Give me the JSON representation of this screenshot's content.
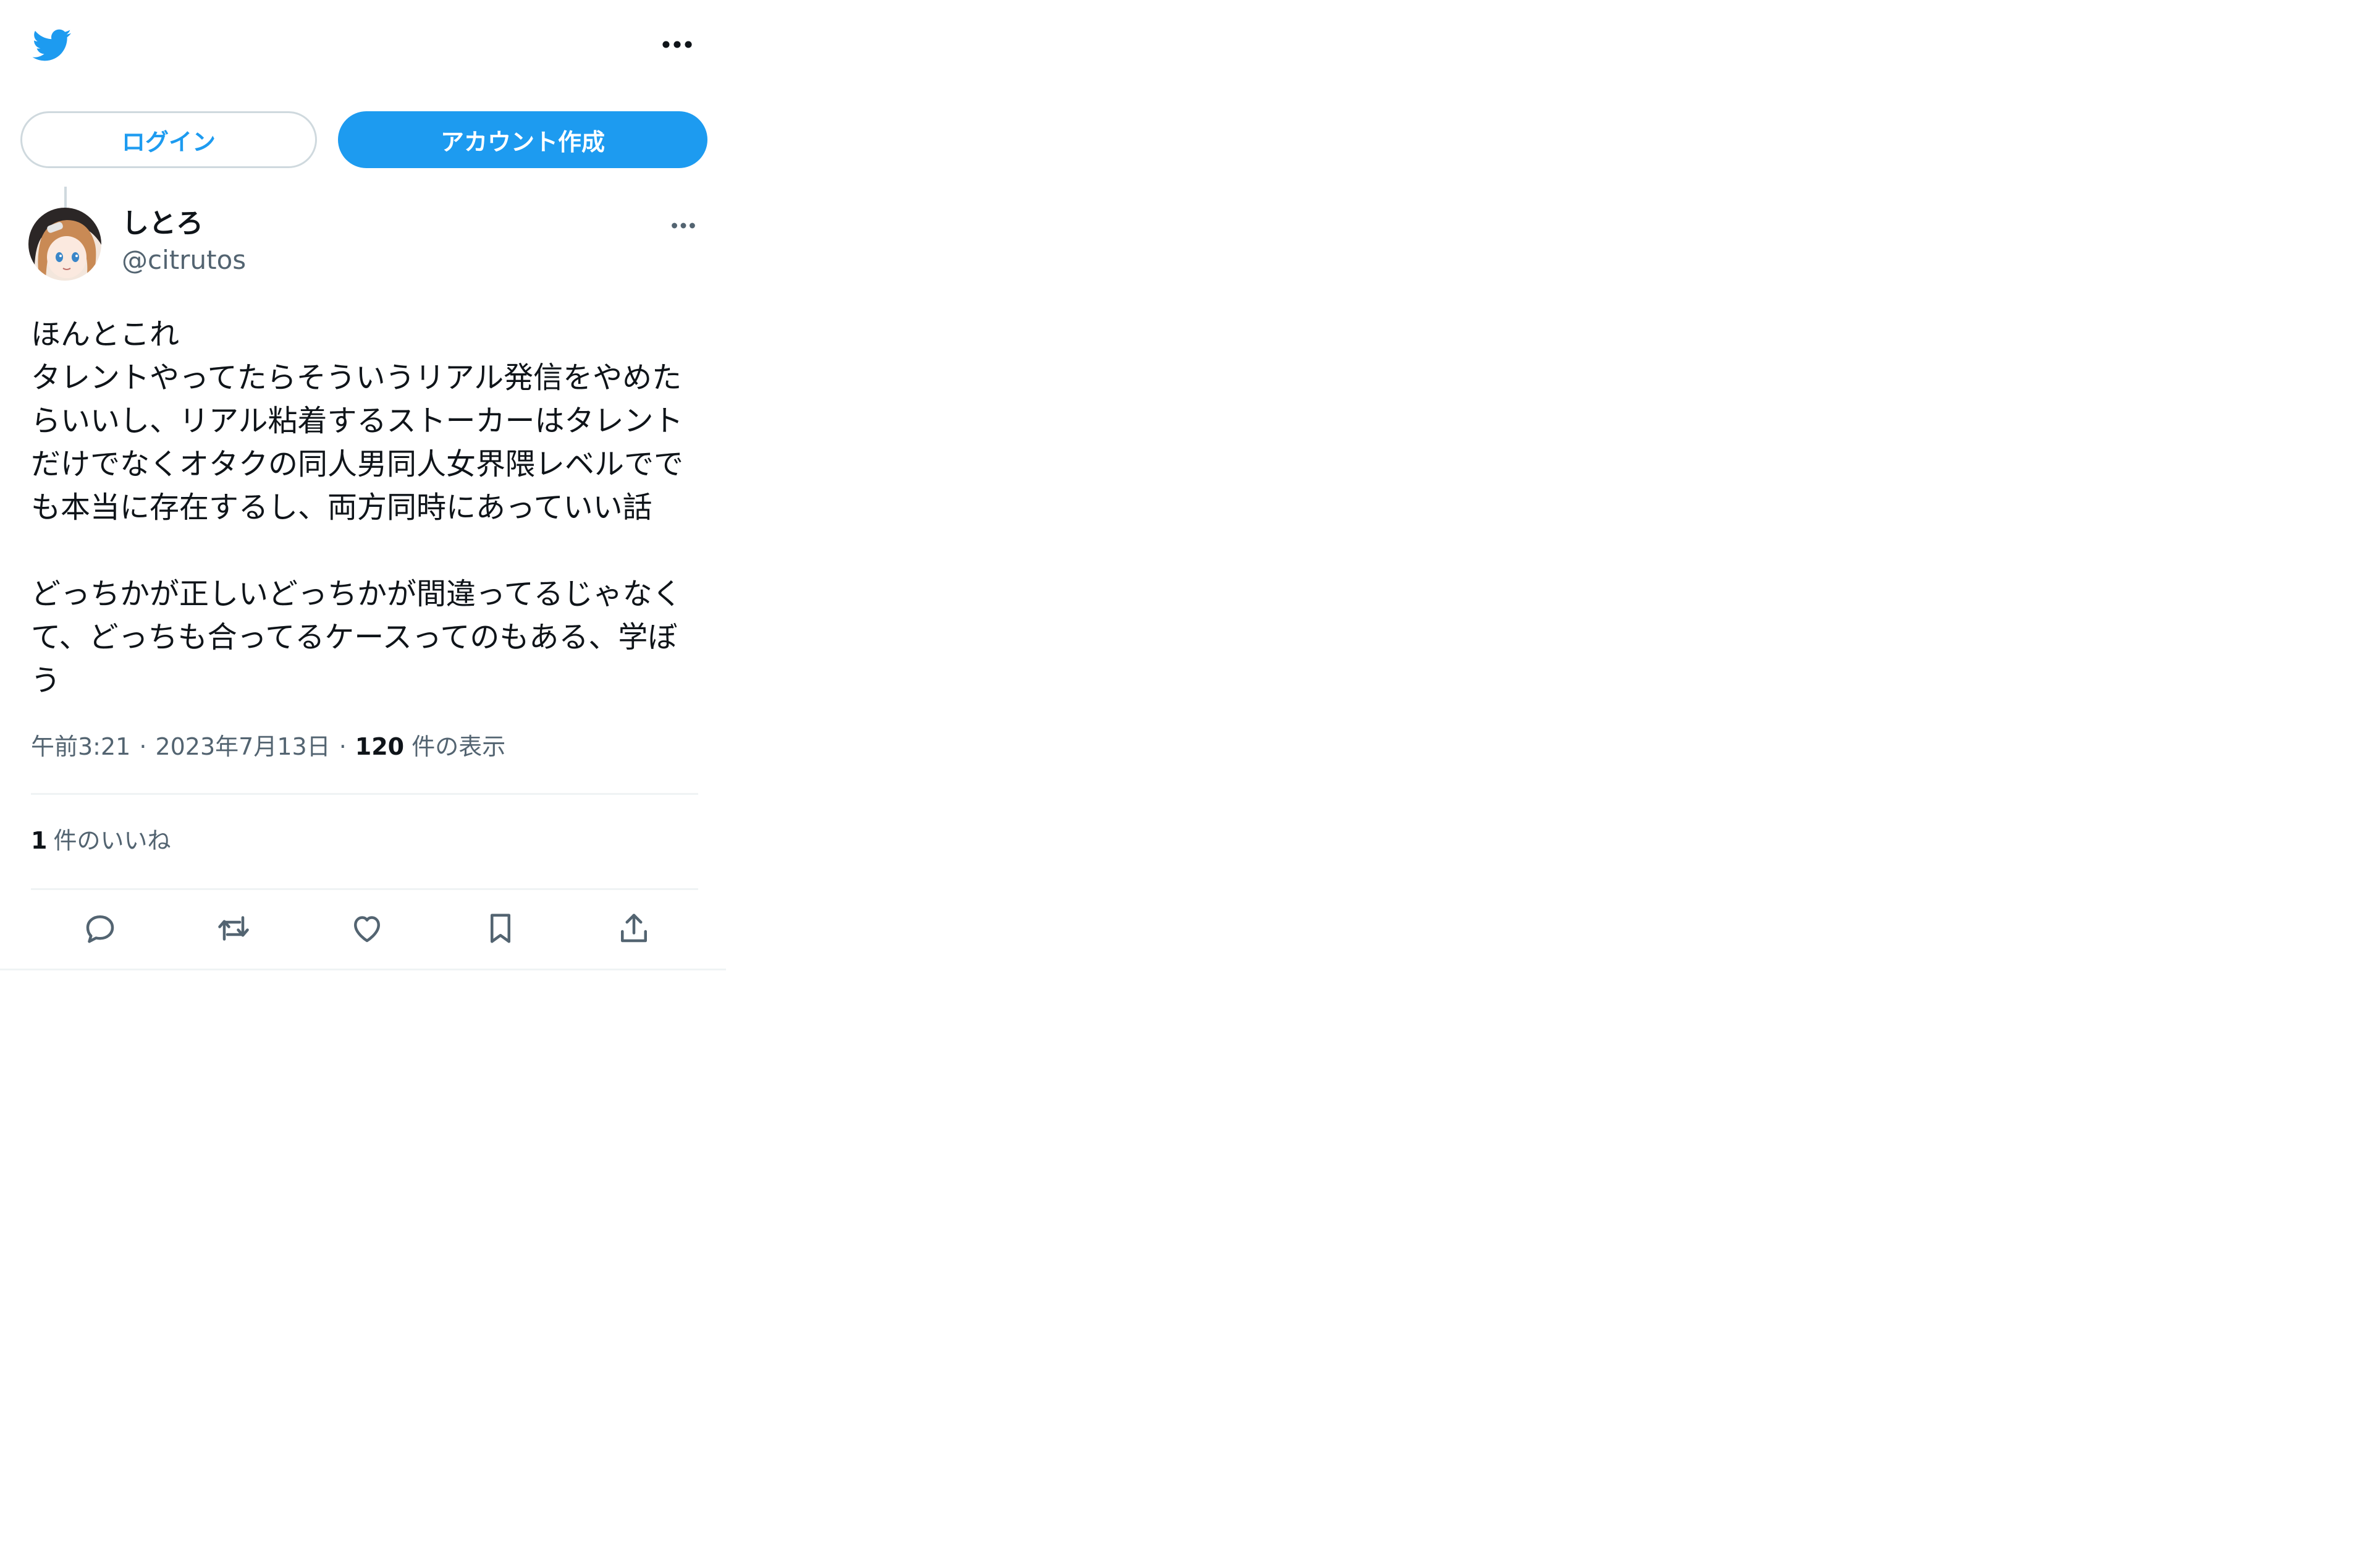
{
  "header": {
    "logo_icon": "twitter-bird-icon",
    "more_icon": "more-dots-icon"
  },
  "auth": {
    "login_label": "ログイン",
    "signup_label": "アカウント作成"
  },
  "tweet": {
    "author": {
      "display_name": "しとろ",
      "handle": "@citrutos"
    },
    "text": "ほんとこれ\nタレントやってたらそういうリアル発信をやめたらいいし、リアル粘着するストーカーはタレントだけでなくオタクの同人男同人女界隈レベルででも本当に存在するし、両方同時にあっていい話\n\nどっちかが正しいどっちかが間違ってるじゃなくて、どっちも合ってるケースってのもある、学ぼう",
    "time": "午前3:21",
    "date": "2023年7月13日",
    "views_count": "120",
    "views_label": "件の表示",
    "likes_count": "1",
    "likes_label": "件のいいね"
  },
  "actions": [
    "reply-icon",
    "retweet-icon",
    "like-icon",
    "bookmark-icon",
    "share-icon"
  ],
  "colors": {
    "accent": "#1d9bf0",
    "secondary_text": "#536471",
    "primary_text": "#0f1419",
    "border": "#cfd9de",
    "divider": "#eff3f4"
  }
}
